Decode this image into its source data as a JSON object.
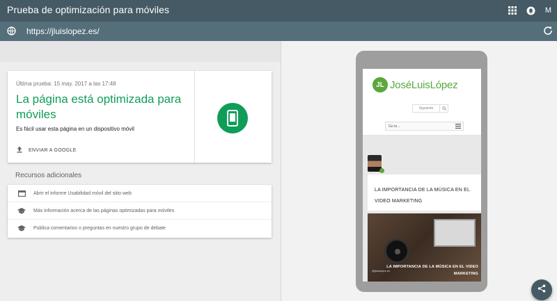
{
  "app": {
    "title": "Prueba de optimización para móviles",
    "account_initial": "M"
  },
  "url_bar": {
    "url": "https://jluislopez.es/"
  },
  "result": {
    "date": "Última prueba: 15 may. 2017 a las 17:48",
    "headline": "La página está optimizada para móviles",
    "description": "Es fácil usar esta página en un dispositivo móvil",
    "send_label": "ENVIAR A GOOGLE"
  },
  "resources": {
    "title": "Recursos adicionales",
    "items": [
      {
        "label": "Abrir el informe Usabilidad móvil del sitio web",
        "icon": "report-icon"
      },
      {
        "label": "Más información acerca de las páginas optimizadas para móviles",
        "icon": "school-icon"
      },
      {
        "label": "Publica comentarios o preguntas en nuestro grupo de debate",
        "icon": "school-icon"
      }
    ]
  },
  "preview": {
    "logo_initials": "JL",
    "site_name": "JoséLuisLópez",
    "search_placeholder": "Siguiente",
    "goto_label": "Go to...",
    "post_title": "LA IMPORTANCIA DE LA MÚSICA EN EL VIDEO MARKETING",
    "featured_caption": "LA IMPORTANCIA DE LA MÚSICA EN EL VIDEO MARKETING",
    "featured_mark": "@jluislopez.es"
  },
  "colors": {
    "topbar": "#455a64",
    "urlbar": "#546e7a",
    "success": "#0f9d58",
    "brand_green": "#5aa83a"
  }
}
